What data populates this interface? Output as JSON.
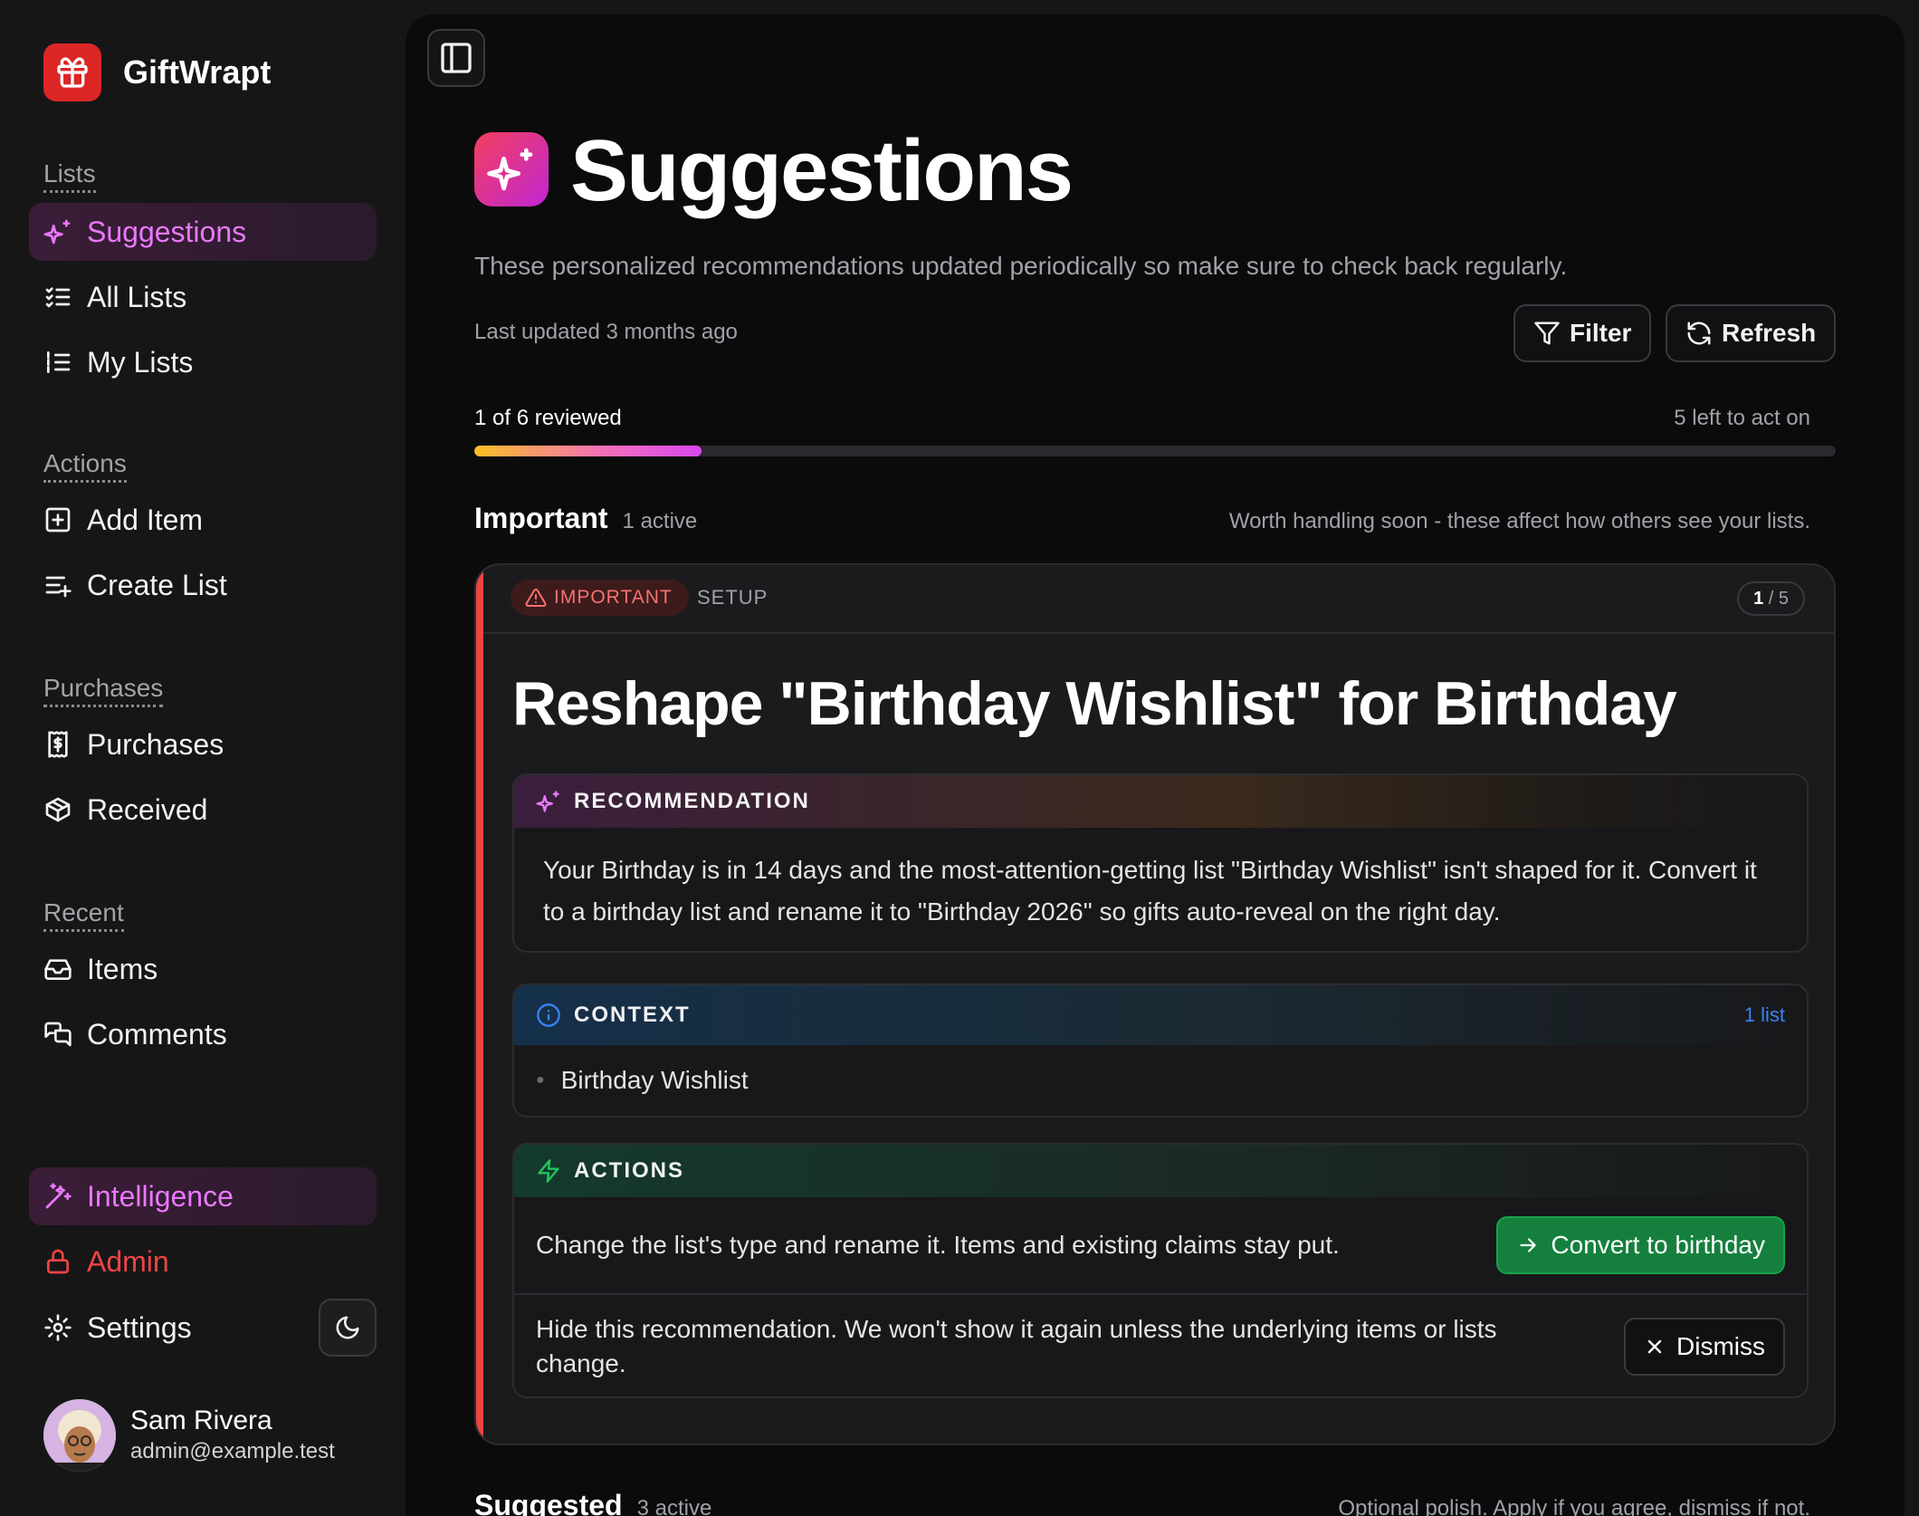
{
  "app": {
    "name": "GiftWrapt"
  },
  "sidebar": {
    "sections": [
      {
        "label": "Lists",
        "items": [
          {
            "label": "Suggestions",
            "icon": "sparkles-icon",
            "active": true
          },
          {
            "label": "All Lists",
            "icon": "list-checks-icon"
          },
          {
            "label": "My Lists",
            "icon": "list-ordered-icon"
          }
        ]
      },
      {
        "label": "Actions",
        "items": [
          {
            "label": "Add Item",
            "icon": "square-plus-icon"
          },
          {
            "label": "Create List",
            "icon": "list-plus-icon"
          }
        ]
      },
      {
        "label": "Purchases",
        "items": [
          {
            "label": "Purchases",
            "icon": "receipt-icon"
          },
          {
            "label": "Received",
            "icon": "package-icon"
          }
        ]
      },
      {
        "label": "Recent",
        "items": [
          {
            "label": "Items",
            "icon": "inbox-icon"
          },
          {
            "label": "Comments",
            "icon": "messages-icon"
          }
        ]
      }
    ],
    "bottom": [
      {
        "label": "Intelligence",
        "icon": "wand-icon",
        "active": true
      },
      {
        "label": "Admin",
        "icon": "lock-icon"
      },
      {
        "label": "Settings",
        "icon": "gear-icon"
      }
    ],
    "user": {
      "name": "Sam Rivera",
      "email": "admin@example.test"
    }
  },
  "page": {
    "title": "Suggestions",
    "subtitle": "These personalized recommendations updated periodically so make sure to check back regularly.",
    "last_updated": "Last updated 3 months ago",
    "filter_label": "Filter",
    "refresh_label": "Refresh",
    "progress": {
      "label": "1 of 6 reviewed",
      "remaining": "5 left to act on",
      "reviewed": 1,
      "total": 6
    }
  },
  "groups": {
    "important": {
      "title": "Important",
      "count": "1 active",
      "note": "Worth handling soon - these affect how others see your lists."
    },
    "suggested": {
      "title": "Suggested",
      "count": "3 active",
      "note": "Optional polish. Apply if you agree, dismiss if not."
    }
  },
  "card": {
    "badge": "IMPORTANT",
    "category": "SETUP",
    "position_current": "1",
    "position_sep": "/ 5",
    "title": "Reshape \"Birthday Wishlist\" for Birthday",
    "recommendation": {
      "heading": "RECOMMENDATION",
      "body": "Your Birthday is in 14 days and the most-attention-getting list \"Birthday Wishlist\" isn't shaped for it. Convert it to a birthday list and rename it to \"Birthday 2026\" so gifts auto-reveal on the right day."
    },
    "context": {
      "heading": "CONTEXT",
      "count": "1 list",
      "items": [
        "Birthday Wishlist"
      ]
    },
    "actions": {
      "heading": "ACTIONS",
      "primary_text": "Change the list's type and rename it. Items and existing claims stay put.",
      "primary_button": "Convert to birthday",
      "dismiss_text": "Hide this recommendation. We won't show it again unless the underlying items or lists change.",
      "dismiss_button": "Dismiss"
    }
  },
  "colors": {
    "accent_magenta": "#e879f9",
    "important_red": "#ef4444",
    "action_green": "#15803d",
    "info_blue": "#3b82f6"
  }
}
